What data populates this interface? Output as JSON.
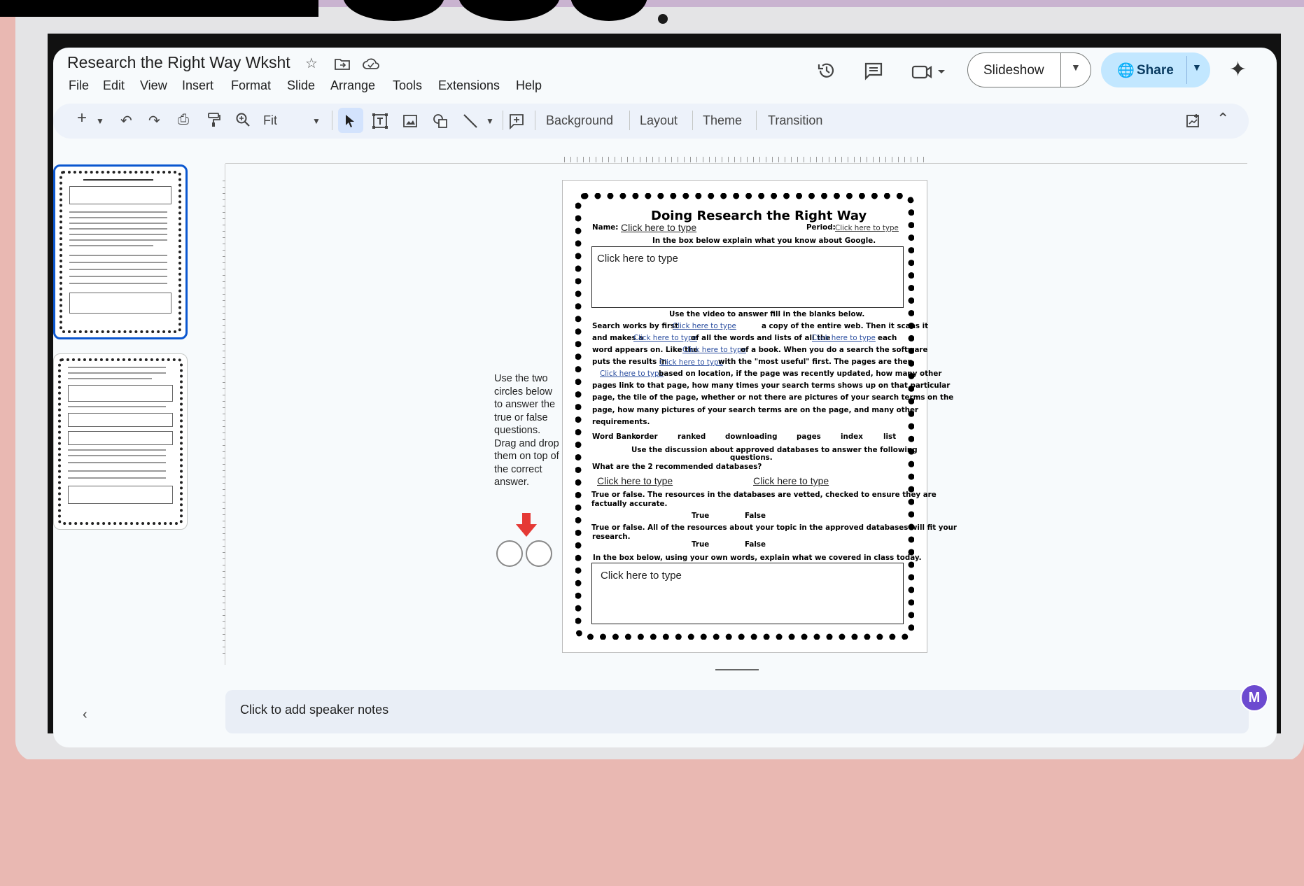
{
  "app": {
    "doc_title": "Research the Right Way Wksht",
    "menu": [
      "File",
      "Edit",
      "View",
      "Insert",
      "Format",
      "Slide",
      "Arrange",
      "Tools",
      "Extensions",
      "Help"
    ],
    "slideshow_label": "Slideshow",
    "share_label": "Share"
  },
  "toolbar": {
    "zoom": "Fit",
    "background": "Background",
    "layout": "Layout",
    "theme": "Theme",
    "transition": "Transition"
  },
  "canvas": {
    "instructions": "Use the two circles below to answer the true or false questions. Drag and drop them on top of the correct answer."
  },
  "worksheet": {
    "title": "Doing Research the Right Way",
    "name_label": "Name:",
    "period_label": "Period:",
    "placeholder": "Click here to type",
    "box1_prompt": "In the box below explain what you know about Google.",
    "video_prompt": "Use the video to answer fill in the blanks below.",
    "p1a": "Search works by first",
    "p1b": "a copy of the entire web. Then it scans it",
    "p2a": "and makes a",
    "p2b": "of all the words and lists of all the",
    "p2c": "each",
    "p3a": "word appears on. Like the",
    "p3b": "of a book. When you do a search the software",
    "p4a": "puts the results in",
    "p4b": "with the \"most useful\" first. The pages are then",
    "p5b": "based on location, if the page was recently updated, how many other",
    "p6": "pages link to that page, how many times your search terms shows up on that particular",
    "p7": "page, the tile of the page, whether or not there are pictures of your search terms on the",
    "p8": "page, how many pictures of your search terms are on the page, and many other",
    "p9": "requirements.",
    "word_bank_label": "Word Bank:",
    "word_bank": [
      "order",
      "ranked",
      "downloading",
      "pages",
      "index",
      "list"
    ],
    "db_prompt_1": "Use the discussion about approved databases to answer the following",
    "db_prompt_2": "questions.",
    "q1": "What are the 2 recommended databases?",
    "q2a": "True or false. The resources in the databases are vetted, checked to ensure they are",
    "q2b": "factually accurate.",
    "true_label": "True",
    "false_label": "False",
    "q3a": "True or false. All of the resources about your topic in the approved databases will fit your",
    "q3b": "research.",
    "box2_prompt": "In the box below, using your own words, explain what we covered in class today."
  },
  "notes": {
    "placeholder": "Click to add speaker notes"
  },
  "icons": {
    "star": "star-icon",
    "folder": "move-folder-icon",
    "cloud": "cloud-status-icon",
    "history": "history-icon",
    "comment": "comment-icon",
    "meet": "video-call-icon",
    "gemini": "gemini-sparkle-icon",
    "globe": "globe-icon"
  },
  "colors": {
    "share_bg": "#c2e7ff",
    "selected_thumb": "#0b57d0",
    "arrow": "#e53935",
    "badge": "#6c4ad0"
  }
}
